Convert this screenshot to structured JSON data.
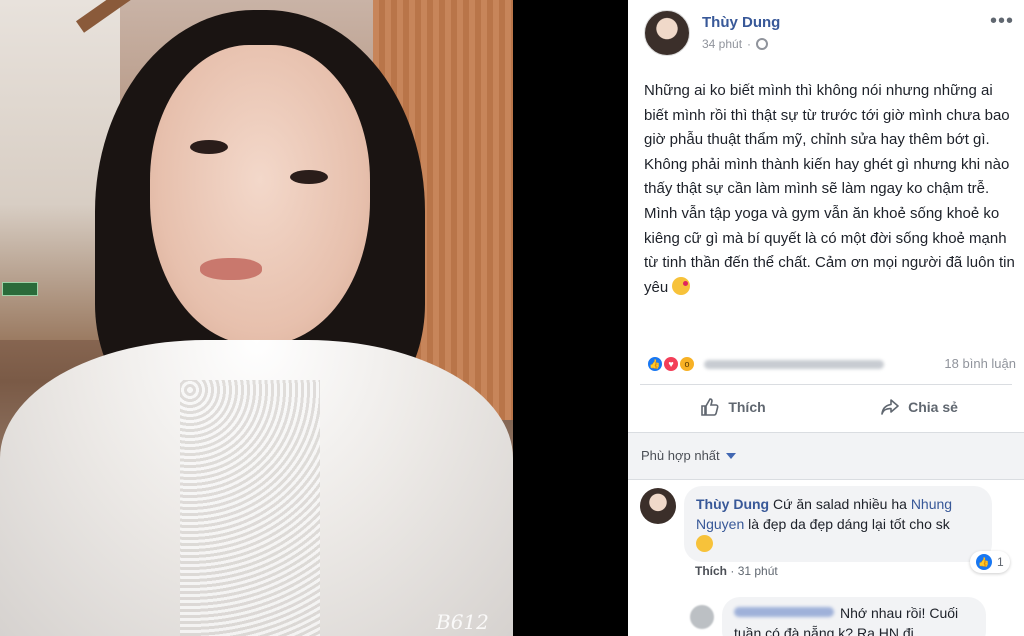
{
  "photo": {
    "watermark": "B612"
  },
  "post": {
    "author": "Thùy Dung",
    "time": "34 phút",
    "text": "Những ai ko biết mình thì không nói nhưng những ai biết mình rồi thì thật sự từ trước tới giờ mình chưa bao giờ phẫu thuật thẩm mỹ, chỉnh sửa hay thêm bớt gì. Không phải mình thành kiến hay ghét gì nhưng khi nào thấy thật sự cần làm mình sẽ làm ngay ko chậm trễ. Mình vẫn tập yoga và gym vẫn ăn khoẻ sống khoẻ ko kiêng cữ gì mà bí quyết là có một đời sống khoẻ mạnh từ tinh thần đến thể chất. Cảm ơn mọi người đã luôn tin yêu",
    "comments_count": "18 bình luận",
    "actions": {
      "like": "Thích",
      "share": "Chia sẻ"
    },
    "filter": "Phù hợp nhất"
  },
  "comment": {
    "author": "Thùy Dung",
    "text_before_tag": " Cứ ăn salad nhiều ha ",
    "tag": "Nhung Nguyen",
    "text_after_tag": " là đẹp da đẹp dáng lại tốt cho sk",
    "like_count": "1",
    "like_label": "Thích",
    "time": "31 phút"
  },
  "reply": {
    "text": "Nhớ nhau rồi! Cuối tuần có đà nẵng k? Ra HN đi"
  },
  "colors": {
    "link": "#385898",
    "like_blue": "#1877f2",
    "love_red": "#f33e58",
    "wow_yellow": "#f7b125"
  }
}
